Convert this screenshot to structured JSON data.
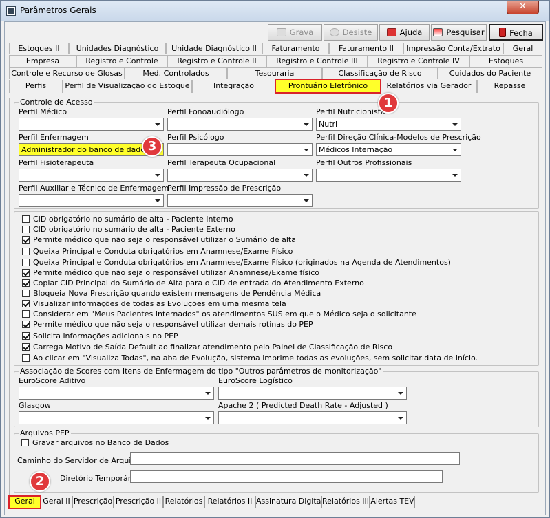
{
  "window": {
    "title": "Parâmetros Gerais",
    "close_glyph": "✕"
  },
  "toolbar": {
    "grava": "Grava",
    "desiste": "Desiste",
    "ajuda": "Ajuda",
    "pesquisar": "Pesquisar",
    "fecha": "Fecha"
  },
  "tabs": {
    "row1": [
      "Estoques II",
      "Unidades Diagnóstico",
      "Unidade Diagnóstico II",
      "Faturamento",
      "Faturamento II",
      "Impressão Conta/Extrato",
      "Geral"
    ],
    "row2": [
      "Empresa",
      "Registro e Controle",
      "Registro e Controle II",
      "Registro e Controle III",
      "Registro e Controle IV",
      "Estoques"
    ],
    "row3": [
      "Controle e Recurso de Glosas",
      "Med. Controlados",
      "Tesouraria",
      "Classificação de Risco",
      "Cuidados do Paciente"
    ],
    "row4": [
      "Perfis",
      "Perfil de Visualização do Estoque",
      "Integração",
      "Prontuário Eletrônico",
      "Relatórios via Gerador",
      "Repasse"
    ]
  },
  "access": {
    "group_title": "Controle de Acesso",
    "perfil_medico": {
      "label": "Perfil Médico",
      "value": ""
    },
    "perfil_fono": {
      "label": "Perfil Fonoaudiólogo",
      "value": ""
    },
    "perfil_nutri": {
      "label": "Perfil Nutricionista",
      "value": "Nutri"
    },
    "perfil_enf": {
      "label": "Perfil Enfermagem",
      "value": "Administrador do banco de dados"
    },
    "perfil_psico": {
      "label": "Perfil Psicólogo",
      "value": ""
    },
    "perfil_direcao": {
      "label": "Perfil Direção Clínica-Modelos de Prescrição",
      "value": "Médicos Internação"
    },
    "perfil_fisio": {
      "label": "Perfil Fisioterapeuta",
      "value": ""
    },
    "perfil_to": {
      "label": "Perfil Terapeuta Ocupacional",
      "value": ""
    },
    "perfil_outros": {
      "label": "Perfil Outros Profissionais",
      "value": ""
    },
    "perfil_aux": {
      "label": "Perfil Auxiliar e Técnico de Enfermagem",
      "value": ""
    },
    "perfil_impressao": {
      "label": "Perfil Impressão de Prescrição",
      "value": ""
    }
  },
  "options": [
    {
      "label": "CID obrigatório no sumário de alta - Paciente Interno",
      "checked": false
    },
    {
      "label": "CID obrigatório no sumário de alta - Paciente Externo",
      "checked": false
    },
    {
      "label": "Permite médico que não seja o responsável utilizar o Sumário de alta",
      "checked": true
    },
    {
      "label": "Queixa Principal e Conduta obrigatórios em Anamnese/Exame Físico",
      "checked": false
    },
    {
      "label": "Queixa Principal e Conduta obrigatórios em Anamnese/Exame Físico (originados na Agenda de Atendimentos)",
      "checked": false
    },
    {
      "label": "Permite médico que não seja o responsável utilizar Anamnese/Exame físico",
      "checked": true
    },
    {
      "label": "Copiar CID Principal do Sumário de Alta para o CID de entrada do Atendimento Externo",
      "checked": true
    },
    {
      "label": "Bloqueia Nova Prescrição quando existem mensagens de Pendência Médica",
      "checked": false
    },
    {
      "label": "Visualizar informações de todas as Evoluções em uma mesma tela",
      "checked": true
    },
    {
      "label": "Considerar em \"Meus Pacientes Internados\" os atendimentos SUS em que o Médico seja o solicitante",
      "checked": false
    },
    {
      "label": "Permite médico que não seja o responsável utilizar demais rotinas do PEP",
      "checked": true
    },
    {
      "label": "Solicita informações adicionais no PEP",
      "checked": true
    },
    {
      "label": "Carrega Motivo de Saída Default ao finalizar atendimento pelo Painel de Classificação de Risco",
      "checked": true
    },
    {
      "label": "Ao clicar em \"Visualiza Todas\", na aba de Evolução, sistema imprime todas as evoluções, sem solicitar data de início.",
      "checked": false
    }
  ],
  "scores": {
    "group_title": "Associação de Scores com Itens de Enfermagem do tipo \"Outros parâmetros de monitorização\"",
    "euro_aditivo": {
      "label": "EuroScore Aditivo",
      "value": ""
    },
    "euro_logistico": {
      "label": "EuroScore Logístico",
      "value": ""
    },
    "glasgow": {
      "label": "Glasgow",
      "value": ""
    },
    "apache": {
      "label": "Apache 2 ( Predicted Death Rate - Adjusted )",
      "value": ""
    }
  },
  "arquivos": {
    "group_title": "Arquivos PEP",
    "gravar": {
      "label": "Gravar arquivos no Banco de Dados",
      "checked": false
    },
    "caminho_label": "Caminho do Servidor de Arquivos:",
    "caminho_value": "",
    "diretorio_label": "Diretório Temporário:",
    "diretorio_value": ""
  },
  "bottom_tabs": [
    "Geral",
    "Geral II",
    "Prescrição",
    "Prescrição II",
    "Relatórios",
    "Relatórios II",
    "Assinatura Digital",
    "Relatórios III",
    "Alertas TEV"
  ],
  "markers": [
    "1",
    "2",
    "3"
  ],
  "colors": {
    "highlight": "#ffff2a",
    "marker": "#e0393c",
    "selection_border": "#d9232a"
  }
}
